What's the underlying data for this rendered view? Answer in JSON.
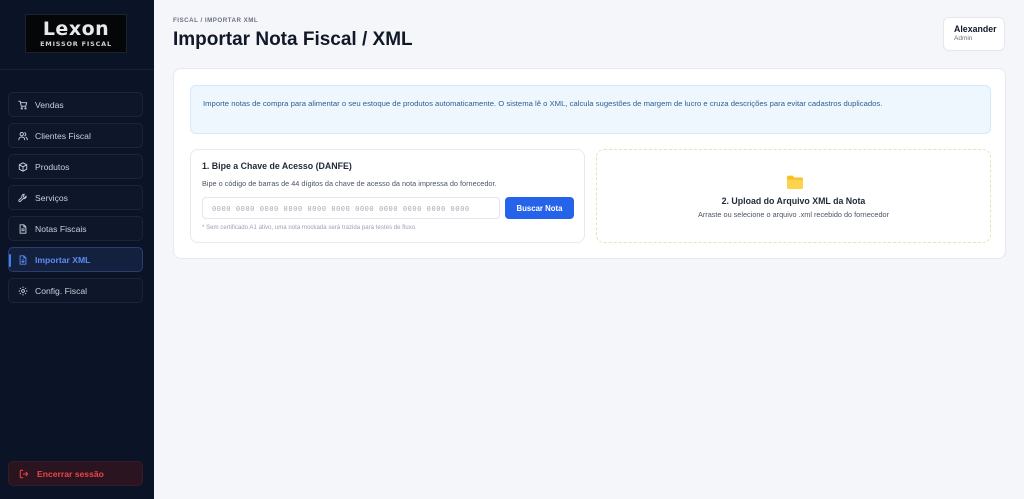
{
  "brand": {
    "name": "Lexon",
    "subtitle": "EMISSOR FISCAL"
  },
  "sidebar": {
    "items": [
      {
        "label": "Vendas",
        "icon": "cart-icon",
        "active": false
      },
      {
        "label": "Clientes Fiscal",
        "icon": "users-icon",
        "active": false
      },
      {
        "label": "Produtos",
        "icon": "box-icon",
        "active": false
      },
      {
        "label": "Serviços",
        "icon": "wrench-icon",
        "active": false
      },
      {
        "label": "Notas Fiscais",
        "icon": "document-icon",
        "active": false
      },
      {
        "label": "Importar XML",
        "icon": "file-import-icon",
        "active": true
      },
      {
        "label": "Config. Fiscal",
        "icon": "gear-icon",
        "active": false
      }
    ],
    "logout_label": "Encerrar sessão"
  },
  "header": {
    "breadcrumb": "FISCAL / IMPORTAR XML",
    "title": "Importar Nota Fiscal / XML"
  },
  "user": {
    "name": "Alexander",
    "role": "Admin"
  },
  "info": {
    "text": "Importe notas de compra para alimentar o seu estoque de produtos automaticamente. O sistema lê o XML, calcula sugestões de margem de lucro e cruza descrições para evitar cadastros duplicados."
  },
  "barcode_panel": {
    "title": "1. Bipe a Chave de Acesso (DANFE)",
    "description": "Bipe o código de barras de 44 dígitos da chave de acesso da nota impressa do fornecedor.",
    "input_placeholder": "0000 0000 0000 0000 0000 0000 0000 0000 0000 0000 0000",
    "input_value": "",
    "button_label": "Buscar Nota",
    "note": "* Sem certificado A1 ativo, uma nota mockada será trazida para testes de fluxo."
  },
  "upload_panel": {
    "title": "2. Upload do Arquivo XML da Nota",
    "subtitle": "Arraste ou selecione o arquivo .xml recebido do fornecedor",
    "icon": "folder-icon"
  },
  "colors": {
    "sidebar_bg": "#0b1326",
    "accent": "#2563eb",
    "active_text": "#5d8cf3",
    "danger": "#ef4444",
    "folder": "#fbbf24"
  }
}
